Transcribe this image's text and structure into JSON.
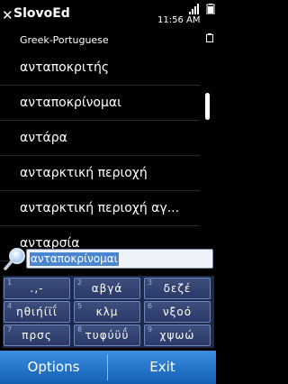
{
  "titlebar": {
    "title": "SlovoEd",
    "clock": "11:56 AM"
  },
  "dictionary": "Greek-Portuguese",
  "words": [
    "ανταποκριτής",
    "ανταποκρίνομαι",
    "αντάρα",
    "ανταρκτική περιοχή",
    "ανταρκτική περιοχή αγ...",
    "ανταρσία"
  ],
  "scroll_position": 0.28,
  "search": {
    "value": "ανταποκρίνομαι"
  },
  "keypad": [
    {
      "num": "1",
      "label": ".,-"
    },
    {
      "num": "2",
      "label": "αβγά"
    },
    {
      "num": "3",
      "label": "δεζέ"
    },
    {
      "num": "4",
      "label": "ηθιήίϊΐ"
    },
    {
      "num": "5",
      "label": "κλμ"
    },
    {
      "num": "6",
      "label": "νξοό"
    },
    {
      "num": "7",
      "label": "πρσς"
    },
    {
      "num": "8",
      "label": "τυφύϋΰ"
    },
    {
      "num": "9",
      "label": "χψωώ"
    }
  ],
  "softkeys": {
    "left": "Options",
    "right": "Exit"
  },
  "icons": {
    "close": "close-icon",
    "signal": "signal-icon",
    "battery": "battery-icon",
    "search": "magnifier-icon"
  }
}
